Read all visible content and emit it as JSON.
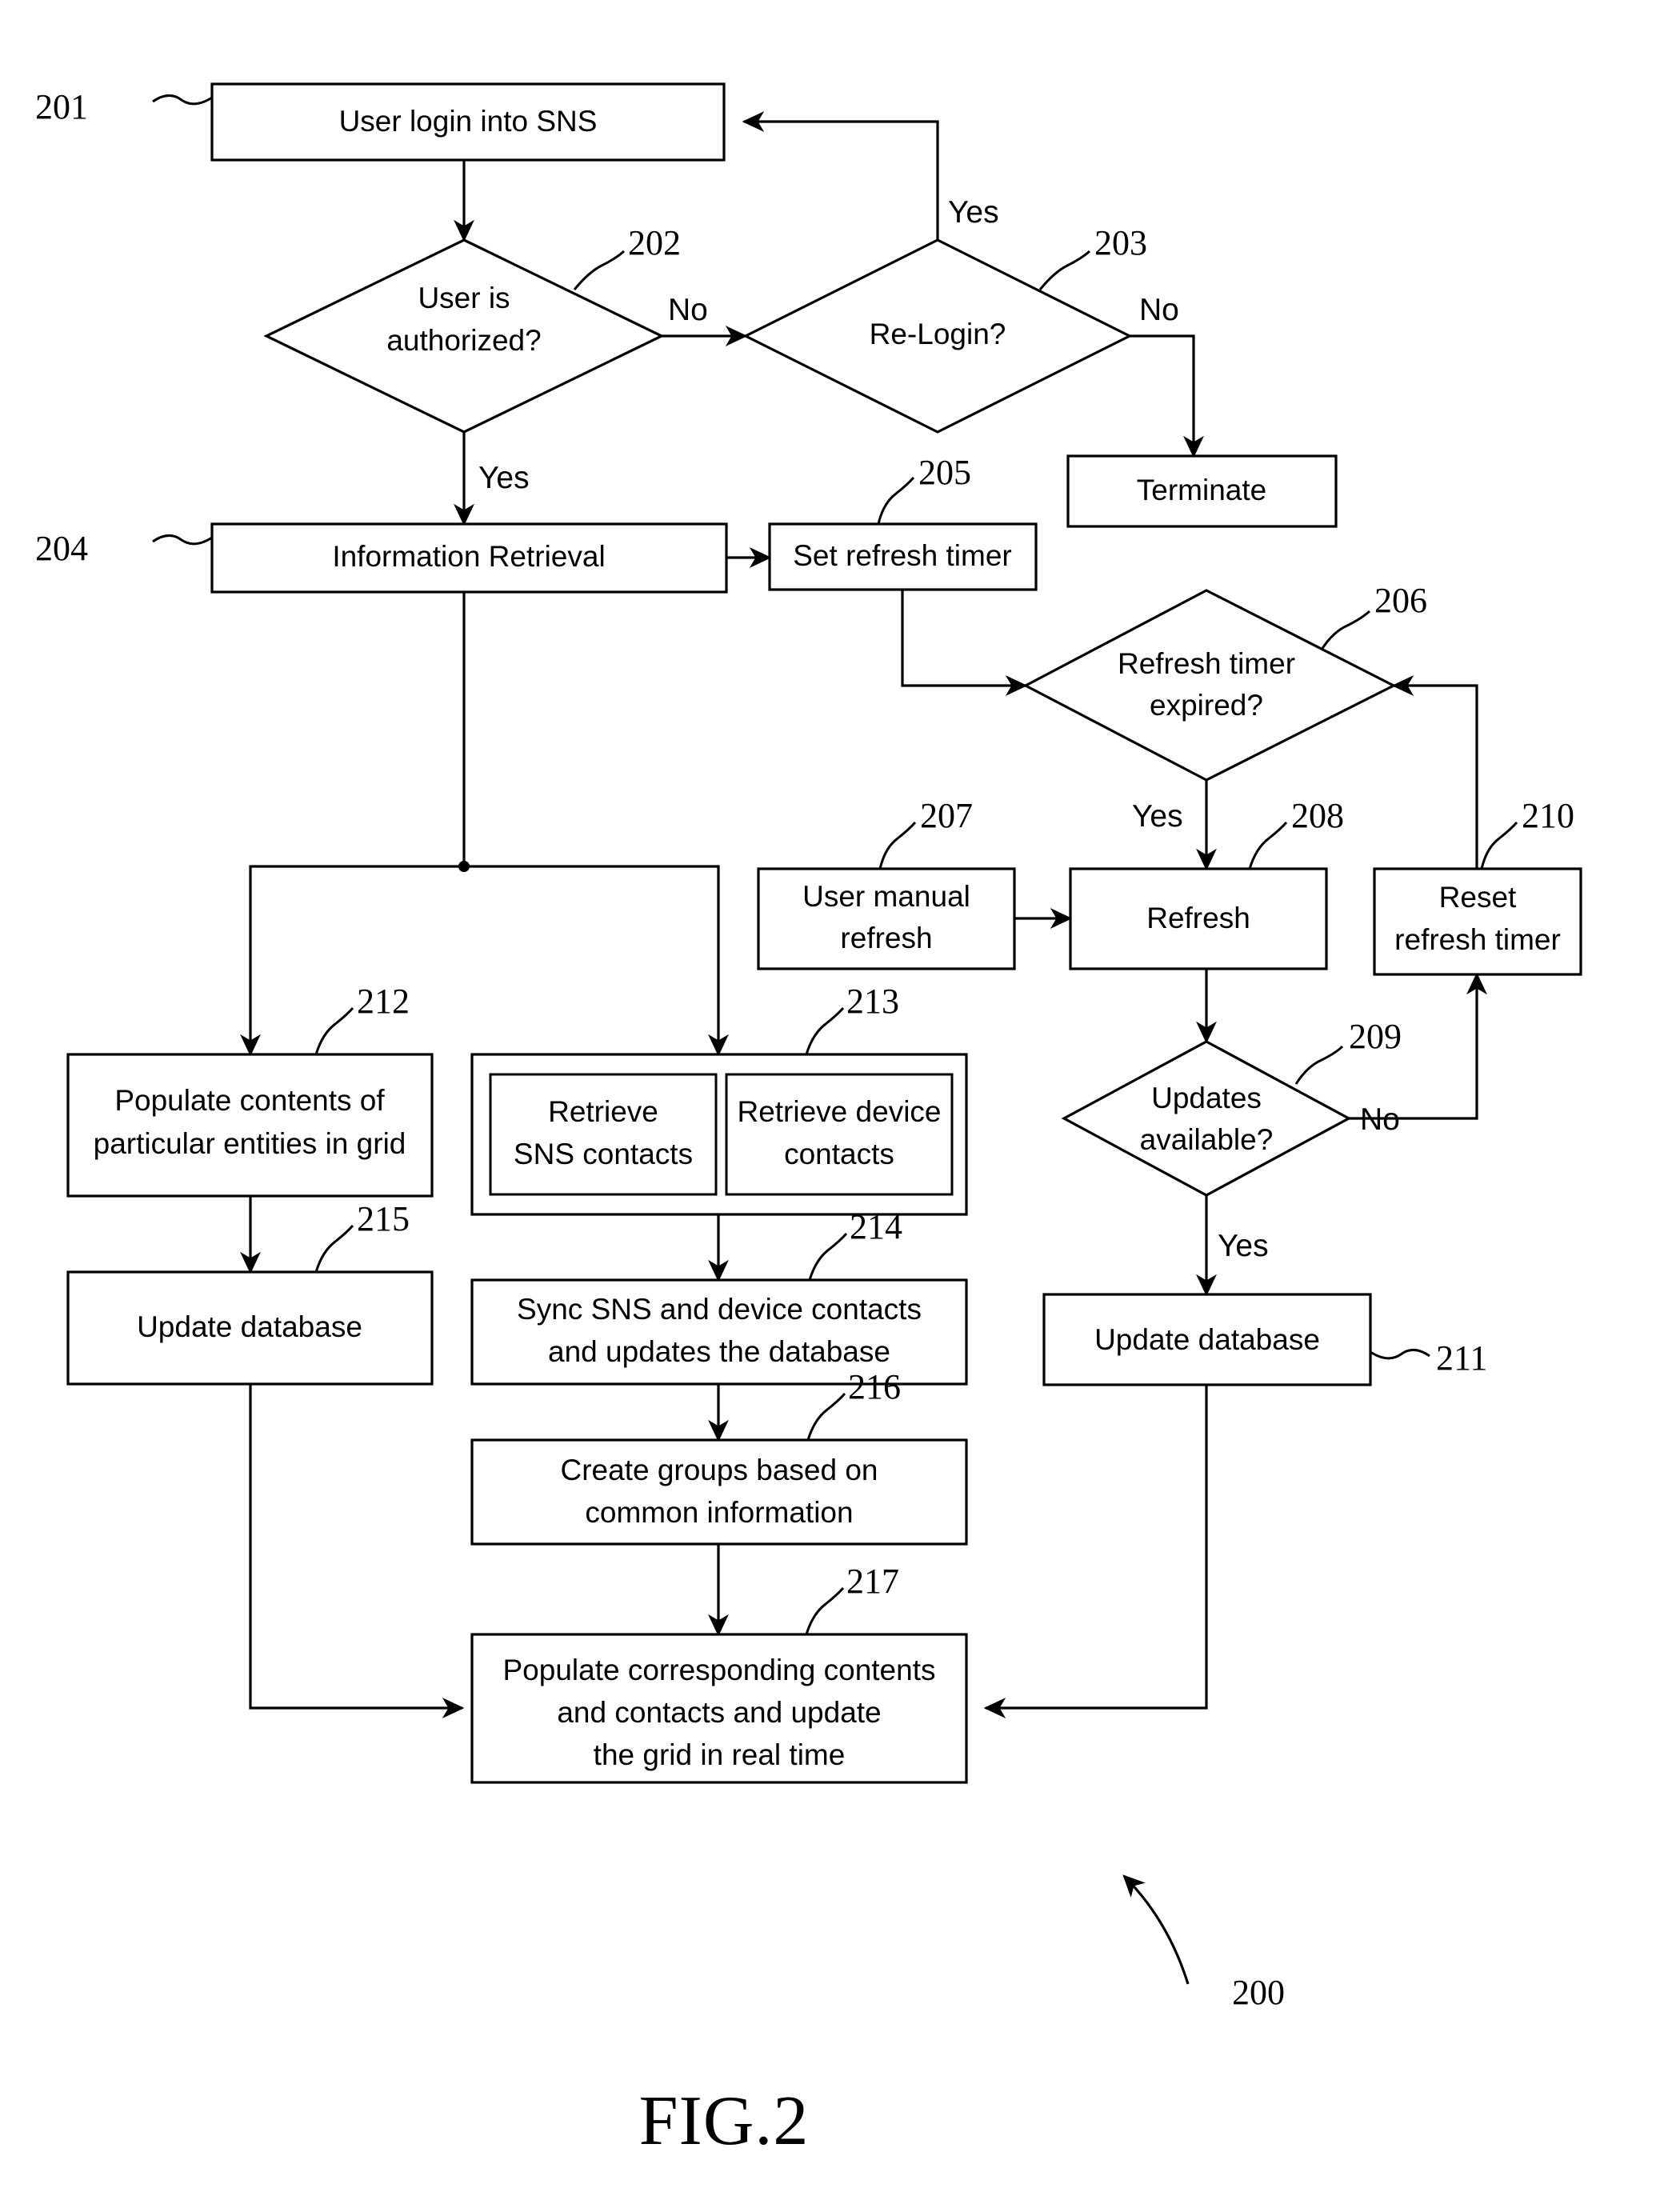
{
  "figure": {
    "caption": "FIG.2",
    "diagram_ref": "200"
  },
  "nodes": {
    "n201": {
      "ref": "201",
      "shape": "process",
      "text": "User login into SNS"
    },
    "n202": {
      "ref": "202",
      "shape": "decision",
      "line1": "User is",
      "line2": "authorized?"
    },
    "n203": {
      "ref": "203",
      "shape": "decision",
      "line1": "Re-Login?",
      "line2": ""
    },
    "terminate": {
      "ref": "",
      "shape": "process",
      "text": "Terminate"
    },
    "n204": {
      "ref": "204",
      "shape": "process",
      "text": "Information Retrieval"
    },
    "n205": {
      "ref": "205",
      "shape": "process",
      "text": "Set refresh timer"
    },
    "n206": {
      "ref": "206",
      "shape": "decision",
      "line1": "Refresh timer",
      "line2": "expired?"
    },
    "n207": {
      "ref": "207",
      "shape": "process",
      "line1": "User manual",
      "line2": "refresh"
    },
    "n208": {
      "ref": "208",
      "shape": "process",
      "text": "Refresh"
    },
    "n209": {
      "ref": "209",
      "shape": "decision",
      "line1": "Updates",
      "line2": "available?"
    },
    "n210": {
      "ref": "210",
      "shape": "process",
      "line1": "Reset",
      "line2": "refresh timer"
    },
    "n211": {
      "ref": "211",
      "shape": "process",
      "text": "Update database"
    },
    "n212": {
      "ref": "212",
      "shape": "process",
      "line1": "Populate contents of",
      "line2": "particular entities in grid"
    },
    "n213": {
      "ref": "213",
      "shape": "group",
      "sub_a_line1": "Retrieve",
      "sub_a_line2": "SNS contacts",
      "sub_b_line1": "Retrieve device",
      "sub_b_line2": "contacts"
    },
    "n214": {
      "ref": "214",
      "shape": "process",
      "line1": "Sync SNS and device contacts",
      "line2": "and updates the database"
    },
    "n215": {
      "ref": "215",
      "shape": "process",
      "text": "Update database"
    },
    "n216": {
      "ref": "216",
      "shape": "process",
      "line1": "Create groups based on",
      "line2": "common information"
    },
    "n217": {
      "ref": "217",
      "shape": "process",
      "line1": "Populate corresponding contents",
      "line2": "and contacts and update",
      "line3": "the grid in real time"
    }
  },
  "edge_labels": {
    "auth_no": "No",
    "auth_yes": "Yes",
    "relogin_yes": "Yes",
    "relogin_no": "No",
    "timer_yes": "Yes",
    "updates_no": "No",
    "updates_yes": "Yes"
  },
  "colors": {
    "stroke": "#000000",
    "fill": "#ffffff"
  }
}
